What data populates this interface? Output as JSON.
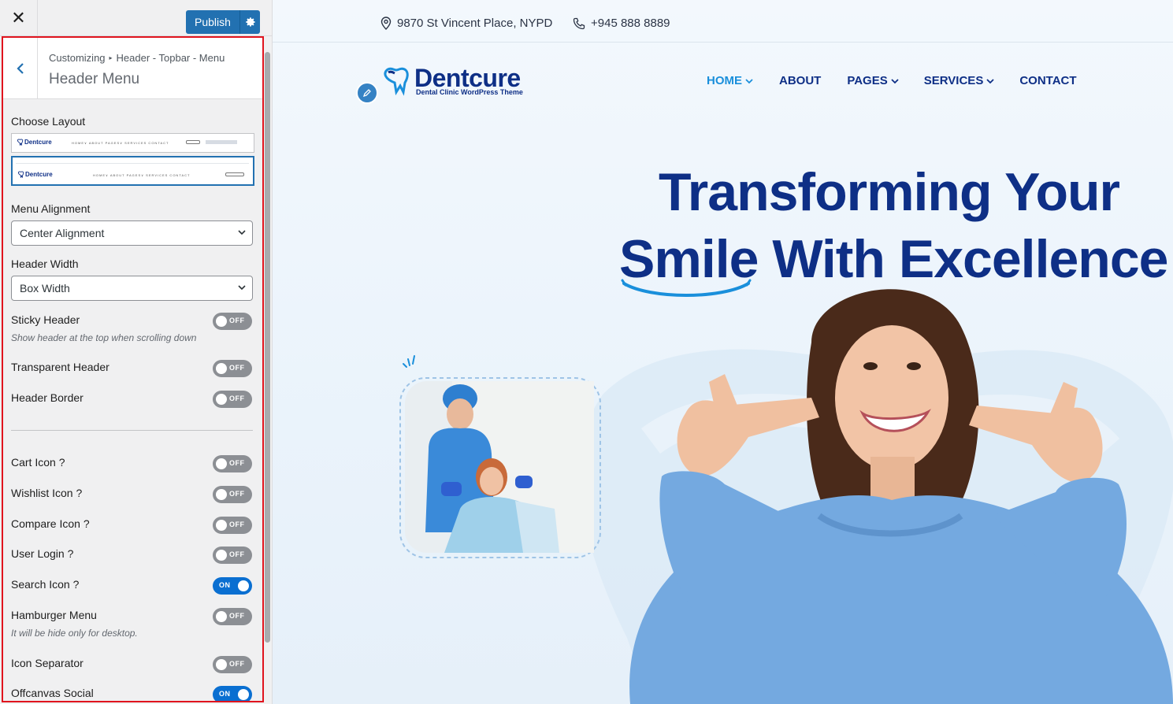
{
  "sidebar": {
    "close_symbol": "✕",
    "publish_label": "Publish",
    "breadcrumb": [
      "Customizing",
      "Header - Topbar - Menu"
    ],
    "breadcrumb_sep": "▸",
    "title": "Header Menu",
    "choose_layout_label": "Choose Layout",
    "layouts": [
      {
        "logo": "Dentcure",
        "nav": "HOME∨  ABOUT  PAGES∨  SERVICES  CONTACT",
        "selected": false
      },
      {
        "logo": "Dentcure",
        "nav": "HOME∨  ABOUT  PAGES∨  SERVICES  CONTACT",
        "selected": true
      }
    ],
    "menu_alignment_label": "Menu Alignment",
    "menu_alignment_value": "Center Alignment",
    "header_width_label": "Header Width",
    "header_width_value": "Box Width",
    "toggles": [
      {
        "label": "Sticky Header",
        "state": "OFF",
        "desc": "Show header at the top when scrolling down"
      },
      {
        "label": "Transparent Header",
        "state": "OFF"
      },
      {
        "label": "Header Border",
        "state": "OFF"
      },
      {
        "label": "Cart Icon ?",
        "state": "OFF"
      },
      {
        "label": "Wishlist Icon ?",
        "state": "OFF"
      },
      {
        "label": "Compare Icon ?",
        "state": "OFF"
      },
      {
        "label": "User Login ?",
        "state": "OFF"
      },
      {
        "label": "Search Icon ?",
        "state": "ON"
      },
      {
        "label": "Hamburger Menu",
        "state": "OFF",
        "desc": "It will be hide only for desktop."
      },
      {
        "label": "Icon Separator",
        "state": "OFF"
      },
      {
        "label": "Offcanvas Social",
        "state": "ON"
      }
    ]
  },
  "preview": {
    "address": "9870 St Vincent Place, NYPD",
    "phone": "+945 888 8889",
    "logo_name": "Dentcure",
    "logo_tagline": "Dental Clinic WordPress Theme",
    "nav": [
      {
        "label": "HOME",
        "dropdown": true,
        "active": true
      },
      {
        "label": "ABOUT",
        "dropdown": false,
        "active": false
      },
      {
        "label": "PAGES",
        "dropdown": true,
        "active": false
      },
      {
        "label": "SERVICES",
        "dropdown": true,
        "active": false
      },
      {
        "label": "CONTACT",
        "dropdown": false,
        "active": false
      }
    ],
    "hero_line1": "Transforming Your",
    "hero_line2": "Smile With Excellence"
  },
  "colors": {
    "brand_navy": "#0e2f86",
    "brand_blue": "#1a8fdb",
    "wp_blue": "#2271b1",
    "toggle_on": "#0a6fd1",
    "toggle_off": "#8c8f94",
    "highlight_border": "#e0141e"
  }
}
